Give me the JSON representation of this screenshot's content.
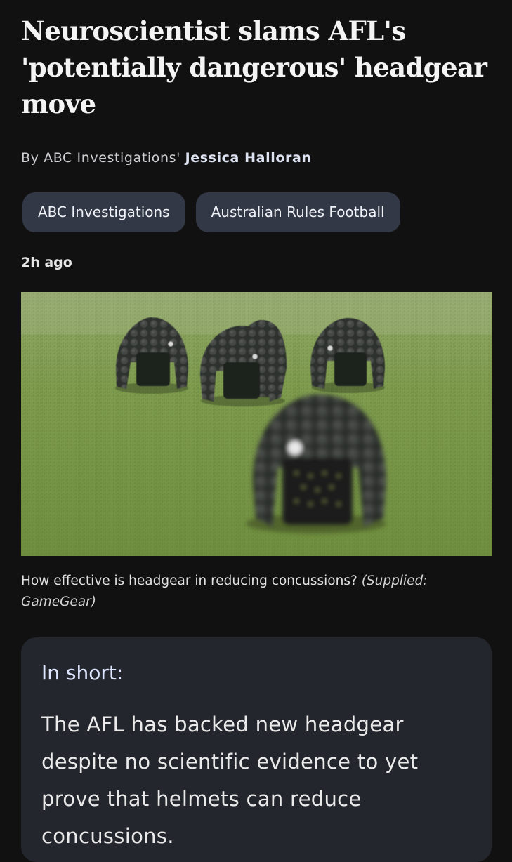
{
  "article": {
    "headline": "Neuroscientist slams AFL's 'potentially dangerous' headgear move",
    "byline_prefix": "By ABC Investigations' ",
    "author": "Jessica Halloran",
    "tags": [
      "ABC Investigations",
      "Australian Rules Football"
    ],
    "timestamp": "2h ago",
    "image": {
      "caption": "How effective is headgear in reducing concussions?",
      "credit": "(Supplied: GameGear)"
    },
    "summary": {
      "heading": "In short:",
      "text": "The AFL has backed new headgear despite no scientific evidence to yet prove that helmets can reduce concussions."
    }
  },
  "colors": {
    "background": "#111112",
    "tag_bg": "#333846",
    "summary_bg": "#24262d",
    "grass": "#7c9a4c",
    "helmet": "#2b2d2b"
  }
}
